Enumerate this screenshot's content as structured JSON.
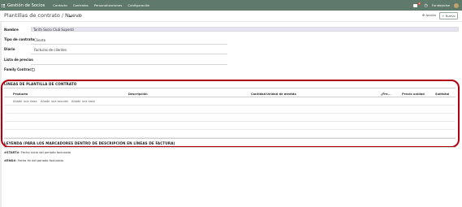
{
  "navbar": {
    "brand": "Gestión de Socios",
    "menu": [
      "Contacto",
      "Contratos",
      "Personalizaciones",
      "Configuración"
    ],
    "badge_count": "2",
    "company": "Fundepulse",
    "user": "Admin"
  },
  "breadcrumb": {
    "parent": "Plantillas de contrato",
    "separator": "/",
    "current": "Nuevo"
  },
  "control": {
    "action_label": "⚙ Acción",
    "new_label": "+ Nuevo"
  },
  "form": {
    "name_label": "Nombre",
    "name_value": "Tarifa Socio Club Superdi",
    "contract_type_label": "Tipo de contrato",
    "contract_type_value": "Cliente",
    "journal_label": "Diario",
    "journal_value": "Facturas de clientes",
    "pricelist_label": "Lista de precios",
    "pricelist_value": "",
    "family_label": "Family Contract",
    "family_checked": false
  },
  "lines": {
    "title": "LINEAS DE PLANTILLA DE CONTRATO",
    "columns": {
      "product": "Producto",
      "description": "Descripción",
      "quantity": "Cantidad",
      "uom": "Unidad de medida",
      "frequency": "¿Fre...",
      "unit_price": "Precio unidad",
      "subtotal": "Subtotal"
    },
    "add_links": [
      "Añadir una línea",
      "Añadir una sección",
      "Añadir una nota"
    ]
  },
  "legend": {
    "title": "LEYENDA (PARA LOS MARCADORES DENTRO DE DESCRIPCIÓN EN LÍNEAS DE FACTURA)",
    "items": [
      {
        "marker": "#START#",
        "text": ": Fecha inicio del periodo facturado"
      },
      {
        "marker": "#END#",
        "text": ": Fecha fin del periodo facturado"
      }
    ]
  },
  "colors": {
    "navbar": "#5f7a6a",
    "highlight": "#b30010"
  }
}
